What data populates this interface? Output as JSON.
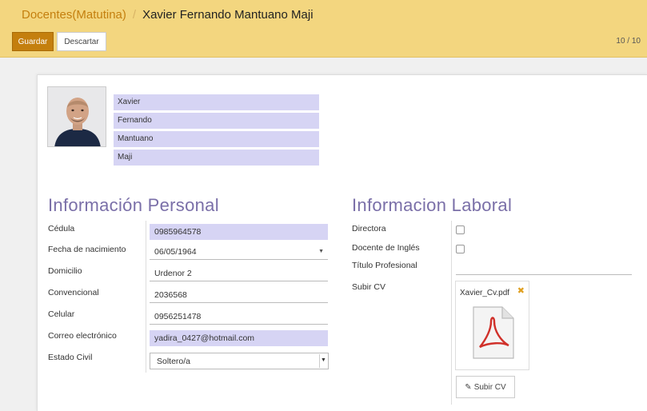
{
  "header": {
    "breadcrumb_parent": "Docentes(Matutina)",
    "breadcrumb_separator": "/",
    "breadcrumb_current": "Xavier Fernando Mantuano Maji",
    "save_label": "Guardar",
    "discard_label": "Descartar",
    "pager": "10 / 10"
  },
  "names": {
    "first_name": "Xavier",
    "second_name": "Fernando",
    "first_surname": "Mantuano",
    "second_surname": "Maji"
  },
  "personal": {
    "title": "Información Personal",
    "cedula_label": "Cédula",
    "cedula_value": "0985964578",
    "birth_label": "Fecha de nacimiento",
    "birth_value": "06/05/1964",
    "address_label": "Domicilio",
    "address_value": "Urdenor 2",
    "phone_label": "Convencional",
    "phone_value": "2036568",
    "mobile_label": "Celular",
    "mobile_value": "0956251478",
    "email_label": "Correo electrónico",
    "email_value": "yadira_0427@hotmail.com",
    "civil_label": "Estado Civil",
    "civil_value": "Soltero/a"
  },
  "work": {
    "title": "Informacion Laboral",
    "director_label": "Directora",
    "english_label": "Docente de Inglés",
    "degree_label": "Título Profesional",
    "cv_label": "Subir CV",
    "cv_filename": "Xavier_Cv.pdf",
    "upload_label": "Subir CV",
    "upload_icon": "paperclip-icon"
  },
  "colors": {
    "header_bg": "#f3d67f",
    "accent": "#c47f0e",
    "required_field": "#d6d4f4",
    "section_title": "#7a6fa8"
  }
}
